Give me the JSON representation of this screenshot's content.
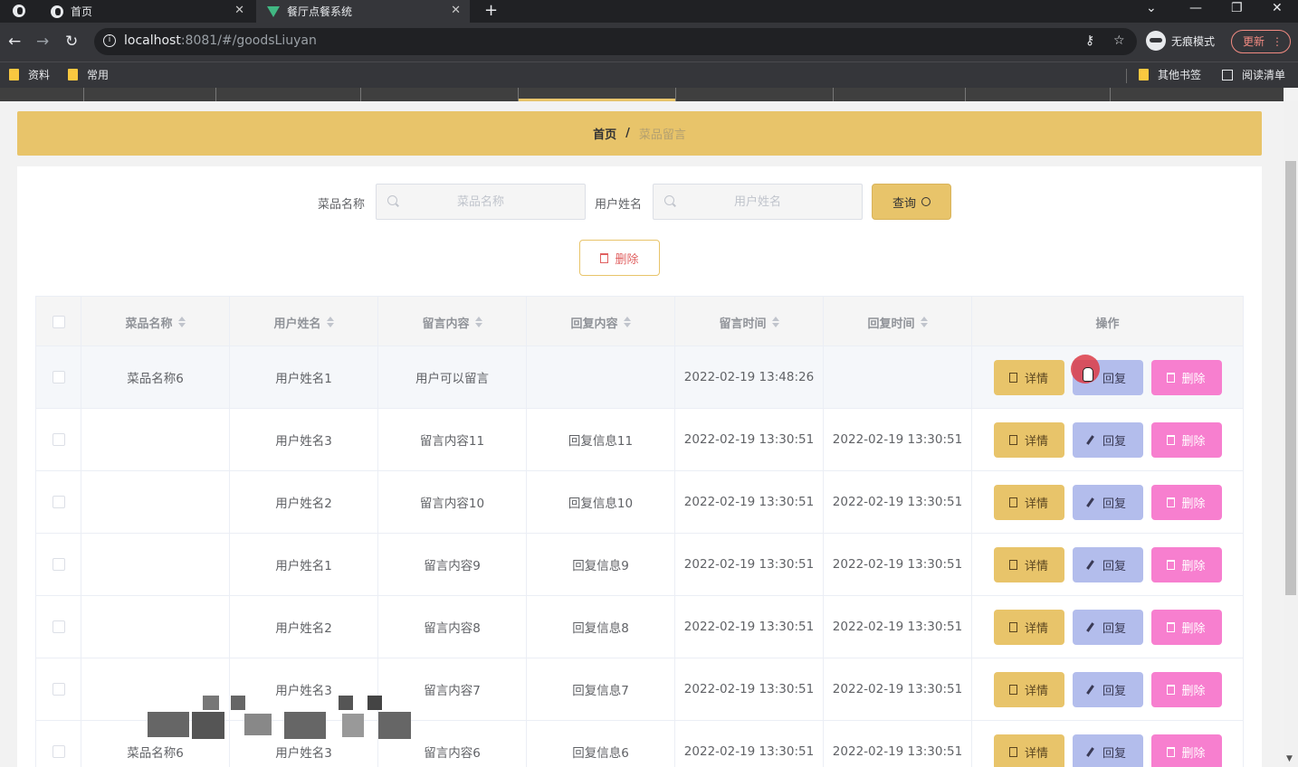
{
  "browser": {
    "tabs": [
      {
        "title": "首页",
        "active": false
      },
      {
        "title": "餐厅点餐系统",
        "active": true
      }
    ],
    "url_host": "localhost",
    "url_rest": ":8081/#/goodsLiuyan",
    "incognito_label": "无痕模式",
    "update_label": "更新",
    "bookmarks": [
      "资料",
      "常用"
    ],
    "bookmarks_right": [
      "其他书签",
      "阅读清单"
    ]
  },
  "breadcrumb": {
    "home": "首页",
    "separator": "/",
    "current": "菜品留言"
  },
  "search": {
    "dish_label": "菜品名称",
    "dish_placeholder": "菜品名称",
    "user_label": "用户姓名",
    "user_placeholder": "用户姓名",
    "query_label": "查询"
  },
  "delete_label": "删除",
  "table": {
    "columns": [
      "菜品名称",
      "用户姓名",
      "留言内容",
      "回复内容",
      "留言时间",
      "回复时间",
      "操作"
    ],
    "rows": [
      {
        "dish": "菜品名称6",
        "user": "用户姓名1",
        "content": "用户可以留言",
        "reply": "",
        "time": "2022-02-19 13:48:26",
        "reply_time": ""
      },
      {
        "dish": "",
        "user": "用户姓名3",
        "content": "留言内容11",
        "reply": "回复信息11",
        "time": "2022-02-19 13:30:51",
        "reply_time": "2022-02-19 13:30:51"
      },
      {
        "dish": "",
        "user": "用户姓名2",
        "content": "留言内容10",
        "reply": "回复信息10",
        "time": "2022-02-19 13:30:51",
        "reply_time": "2022-02-19 13:30:51"
      },
      {
        "dish": "",
        "user": "用户姓名1",
        "content": "留言内容9",
        "reply": "回复信息9",
        "time": "2022-02-19 13:30:51",
        "reply_time": "2022-02-19 13:30:51"
      },
      {
        "dish": "",
        "user": "用户姓名2",
        "content": "留言内容8",
        "reply": "回复信息8",
        "time": "2022-02-19 13:30:51",
        "reply_time": "2022-02-19 13:30:51"
      },
      {
        "dish": "",
        "user": "用户姓名3",
        "content": "留言内容7",
        "reply": "回复信息7",
        "time": "2022-02-19 13:30:51",
        "reply_time": "2022-02-19 13:30:51"
      },
      {
        "dish": "菜品名称6",
        "user": "用户姓名3",
        "content": "留言内容6",
        "reply": "回复信息6",
        "time": "2022-02-19 13:30:51",
        "reply_time": "2022-02-19 13:30:51"
      }
    ],
    "actions": {
      "detail": "详情",
      "reply": "回复",
      "delete": "删除"
    }
  },
  "colors": {
    "accent": "#e8c46a",
    "reply_btn": "#b3bdec",
    "delete_btn": "#f77fcf"
  }
}
